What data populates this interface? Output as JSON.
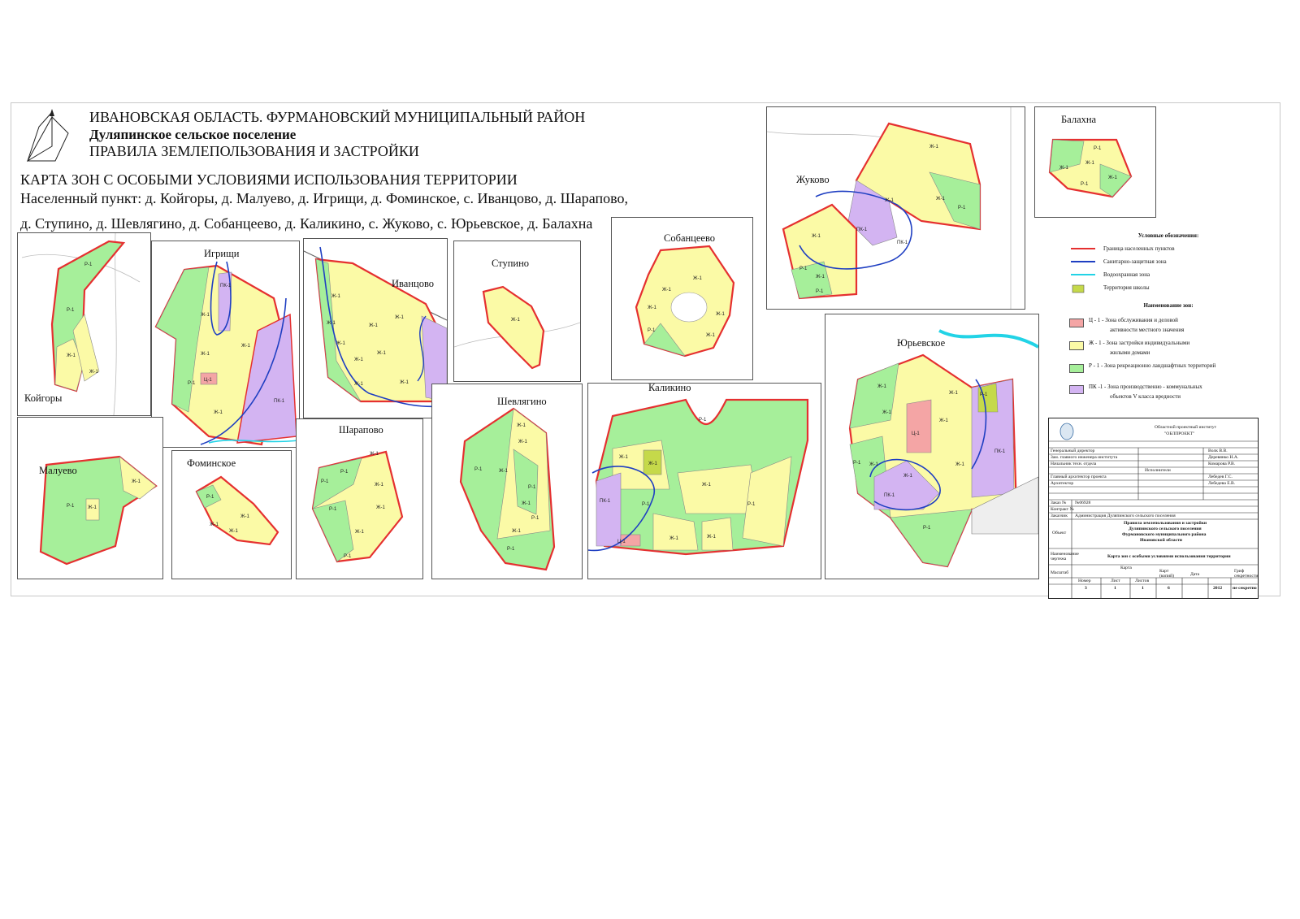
{
  "header": {
    "line1": "ИВАНОВСКАЯ ОБЛАСТЬ.    ФУРМАНОВСКИЙ МУНИЦИПАЛЬНЫЙ РАЙОН",
    "line2": "Дуляпинское сельское поселение",
    "line3": "ПРАВИЛА ЗЕМЛЕПОЛЬЗОВАНИЯ И ЗАСТРОЙКИ",
    "map_title": "КАРТА  ЗОН С ОСОБЫМИ УСЛОВИЯМИ ИСПОЛЬЗОВАНИЯ ТЕРРИТОРИИ",
    "settlements_line1": "Населенный пункт: д. Койгоры, д. Малуево, д. Игрищи, д. Фоминское, с. Иванцово, д. Шарапово,",
    "settlements_line2": "д. Ступино, д. Шевлягино, д. Собанцеево, д. Каликино, с. Жуково, с. Юрьевское, д. Балахна"
  },
  "panels": {
    "koygory": "Койгоры",
    "igrishchi": "Игрищи",
    "ivantsovo": "Иванцово",
    "stupino": "Ступино",
    "sobantseevo": "Собанцеево",
    "zhukovo": "Жуково",
    "balakhna": "Балахна",
    "maluevo": "Малуево",
    "fominskoe": "Фоминское",
    "sharapovo": "Шарапово",
    "shevlyagino": "Шевлягино",
    "kalikino": "Каликино",
    "yurievskoe": "Юрьевское"
  },
  "zone_labels": {
    "zh": "Ж-1",
    "r": "Р-1",
    "pk": "ПК-1",
    "ts": "Ц-1"
  },
  "legend": {
    "title": "Условные обозначения:",
    "items": [
      {
        "text": "Граница населенных пунктов",
        "color": "#e53030"
      },
      {
        "text": "Санитарно-защитная зона",
        "color": "#1f3fc2"
      },
      {
        "text": "Водоохранная зона",
        "color": "#22d3e6"
      },
      {
        "text": "Территория школы",
        "color": "#c5d94a"
      }
    ],
    "zones_title": "Наименование зон:",
    "zones": [
      {
        "line1": "Ц - 1 - Зона обслуживания и деловой",
        "line2": "активности местного значения",
        "color": "#f4a5a5"
      },
      {
        "line1": "Ж - 1 - Зона застройки индивидуальными",
        "line2": "жилыми домами",
        "color": "#fbfaa6"
      },
      {
        "line1": "Р - 1 - Зона рекреационно ландшафтных территорий",
        "line2": "",
        "color": "#a6ef9a"
      },
      {
        "line1": "ПК -1  - Зона производственно - коммунальных",
        "line2": "объектов V класса вредности",
        "color": "#d3b4f2"
      }
    ]
  },
  "stamp": {
    "org1": "Областной проектный институт",
    "org2": "\"ОБЛПРОЕКТ\"",
    "roles": [
      {
        "role": "Генеральный директор",
        "name": "Волк В.В."
      },
      {
        "role": "Зам. главного инженера института",
        "name": "Деревянко Н.А."
      },
      {
        "role": "Начальник техн. отдела",
        "name": "Комарова Р.В."
      }
    ],
    "executors": "Исполнители",
    "exec_roles": [
      {
        "role": "Главный архитектор проекта",
        "name": "Лебедев Г.С."
      },
      {
        "role": "Архитектор",
        "name": "Лебедева Е.В."
      }
    ],
    "order_label": "Заказ №",
    "order_value": "№06928",
    "contract_label": "Контракт №",
    "customer_label": "Заказчик",
    "customer_value": "Администрация Дуляпинского сельского поселения",
    "object_label": "Объект",
    "object_lines": [
      "Правила землепользования и застройки",
      "Дуляпинского сельского поселения",
      "Фурмановского муниципального района",
      "Ивановской области"
    ],
    "drawing_label": "Наименование чертежа",
    "drawing_value": "Карта зон с особыми условиями использования территории",
    "scale_label": "Масштаб",
    "cols": [
      "Номер",
      "Лист",
      "Листов",
      "Карт (копий)",
      "Дата",
      "Гриф секретности"
    ],
    "karta_header": "Карта",
    "values": [
      "3",
      "1",
      "1",
      "6",
      "2012",
      "не секретно"
    ]
  }
}
